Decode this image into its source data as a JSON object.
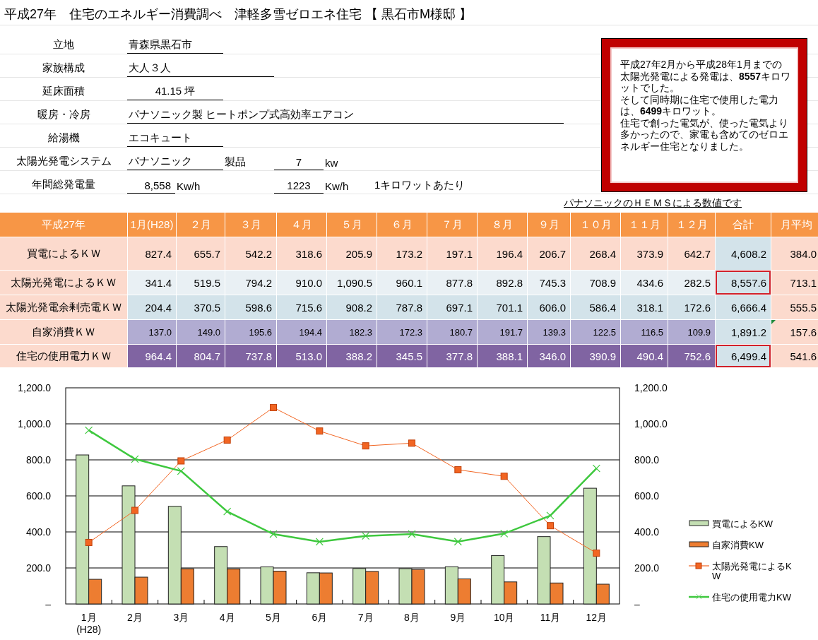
{
  "title": "平成27年　住宅のエネルギー消費調べ　津軽多雪ゼロエネ住宅 【 黒石市M様邸 】",
  "info": {
    "rows": [
      {
        "label": "立地",
        "values": [
          {
            "text": "青森県黒石市",
            "underlined": true
          }
        ]
      },
      {
        "label": "家族構成",
        "values": [
          {
            "text": "大人３人",
            "underlined": true
          }
        ]
      },
      {
        "label": "延床面積",
        "values": [
          {
            "text": "41.15 坪",
            "underlined": true
          }
        ]
      },
      {
        "label": "暖房・冷房",
        "values": [
          {
            "text": "パナソニック製  ヒートポンプ式高効率エアコン",
            "underlined": true
          }
        ]
      },
      {
        "label": "給湯機",
        "values": [
          {
            "text": "エコキュート",
            "underlined": true
          }
        ]
      },
      {
        "label": "太陽光発電システム",
        "values": [
          {
            "text": "パナソニック",
            "underlined": true
          },
          {
            "text": "製品",
            "underlined": false
          },
          {
            "text": "7",
            "underlined": true
          },
          {
            "text": "kw",
            "underlined": false
          }
        ]
      },
      {
        "label": "年間総発電量",
        "values": [
          {
            "text": "8,558",
            "underlined": true
          },
          {
            "text": "Kw/h",
            "underlined": false
          },
          {
            "text": "1223",
            "underlined": true
          },
          {
            "text": "Kw/h",
            "underlined": false
          },
          {
            "text": "1キロワットあたり",
            "underlined": false
          }
        ]
      }
    ]
  },
  "note_box": {
    "paragraphs": [
      "平成27年2月から平成28年1月までの太陽光発電による発電は、**8557**キロワットでした。",
      "そして同時期に住宅で使用した電力は、**6499**キロワット。",
      "住宅で創った電気が、使った電気より多かったので、家電も含めてのゼロエネルギー住宅となりました。"
    ]
  },
  "source_note": "パナソニックのＨＥＭＳによる数値です",
  "table": {
    "columns": [
      "平成27年",
      "1月(H28)",
      "２月",
      "３月",
      "４月",
      "５月",
      "６月",
      "７月",
      "８月",
      "９月",
      "１０月",
      "１１月",
      "１２月",
      "合計",
      "月平均"
    ],
    "rows": [
      {
        "label": "買電によるＫＷ",
        "kind": "peach",
        "values": [
          "827.4",
          "655.7",
          "542.2",
          "318.6",
          "205.9",
          "173.2",
          "197.1",
          "196.4",
          "206.7",
          "268.4",
          "373.9",
          "642.7"
        ],
        "total": "4,608.2",
        "average": "384.0",
        "total_highlighted": false,
        "flagged": false
      },
      {
        "label": "太陽光発電によるＫＷ",
        "kind": "pale",
        "values": [
          "341.4",
          "519.5",
          "794.2",
          "910.0",
          "1,090.5",
          "960.1",
          "877.8",
          "892.8",
          "745.3",
          "708.9",
          "434.6",
          "282.5"
        ],
        "total": "8,557.6",
        "average": "713.1",
        "total_highlighted": true,
        "flagged": false
      },
      {
        "label": "太陽光発電余剰売電ＫＷ",
        "kind": "blue",
        "values": [
          "204.4",
          "370.5",
          "598.6",
          "715.6",
          "908.2",
          "787.8",
          "697.1",
          "701.1",
          "606.0",
          "586.4",
          "318.1",
          "172.6"
        ],
        "total": "6,666.4",
        "average": "555.5",
        "total_highlighted": false,
        "flagged": false
      },
      {
        "label": "自家消費ＫＷ",
        "kind": "lavender",
        "values": [
          "137.0",
          "149.0",
          "195.6",
          "194.4",
          "182.3",
          "172.3",
          "180.7",
          "191.7",
          "139.3",
          "122.5",
          "116.5",
          "109.9"
        ],
        "total": "1,891.2",
        "average": "157.6",
        "total_highlighted": false,
        "flagged": true
      },
      {
        "label": "住宅の使用電力ＫＷ",
        "kind": "purple",
        "values": [
          "964.4",
          "804.7",
          "737.8",
          "513.0",
          "388.2",
          "345.5",
          "377.8",
          "388.1",
          "346.0",
          "390.9",
          "490.4",
          "752.6"
        ],
        "total": "6,499.4",
        "average": "541.6",
        "total_highlighted": true,
        "flagged": false
      }
    ]
  },
  "chart": {
    "chart_data": {
      "type": "bar",
      "categories": [
        "1月\n(H28)",
        "2月",
        "3月",
        "4月",
        "5月",
        "6月",
        "7月",
        "8月",
        "9月",
        "10月",
        "11月",
        "12月"
      ],
      "series": [
        {
          "name": "買電によるKW",
          "type": "bar",
          "color": "#c4dfb3",
          "values": [
            827.4,
            655.7,
            542.2,
            318.6,
            205.9,
            173.2,
            197.1,
            196.4,
            206.7,
            268.4,
            373.9,
            642.7
          ]
        },
        {
          "name": "自家消費KW",
          "type": "bar",
          "color": "#ed7d31",
          "values": [
            137.0,
            149.0,
            195.6,
            194.4,
            182.3,
            172.3,
            180.7,
            191.7,
            139.3,
            122.5,
            116.5,
            109.9
          ]
        },
        {
          "name": "太陽光発電によるKW",
          "type": "line",
          "marker": "square",
          "color": "#f26522",
          "values": [
            341.4,
            519.5,
            794.2,
            910.0,
            1090.5,
            960.1,
            877.8,
            892.8,
            745.3,
            708.9,
            434.6,
            282.5
          ]
        },
        {
          "name": "住宅の使用電力KW",
          "type": "line",
          "marker": "x",
          "color": "#3ec83e",
          "values": [
            964.4,
            804.7,
            737.8,
            513.0,
            388.2,
            345.5,
            377.8,
            388.1,
            346.0,
            390.9,
            490.4,
            752.6
          ]
        }
      ],
      "stacked": false,
      "grid": true,
      "legend": true,
      "ylim": [
        0,
        1200
      ],
      "y2lim": [
        0,
        1200
      ],
      "yticks": [
        {
          "value": 0,
          "label": "–"
        },
        {
          "value": 200,
          "label": "200.0"
        },
        {
          "value": 400,
          "label": "400.0"
        },
        {
          "value": 600,
          "label": "600.0"
        },
        {
          "value": 800,
          "label": "800.0"
        },
        {
          "value": 1000,
          "label": "1,000.0"
        },
        {
          "value": 1200,
          "label": "1,200.0"
        }
      ],
      "y2ticks": [
        {
          "value": 0,
          "label": "–"
        },
        {
          "value": 200,
          "label": "200.0"
        },
        {
          "value": 400,
          "label": "400.0"
        },
        {
          "value": 600,
          "label": "600.0"
        },
        {
          "value": 800,
          "label": "800.0"
        },
        {
          "value": 1000,
          "label": "1,000.0"
        },
        {
          "value": 1200,
          "label": "1,200.0"
        }
      ]
    }
  }
}
